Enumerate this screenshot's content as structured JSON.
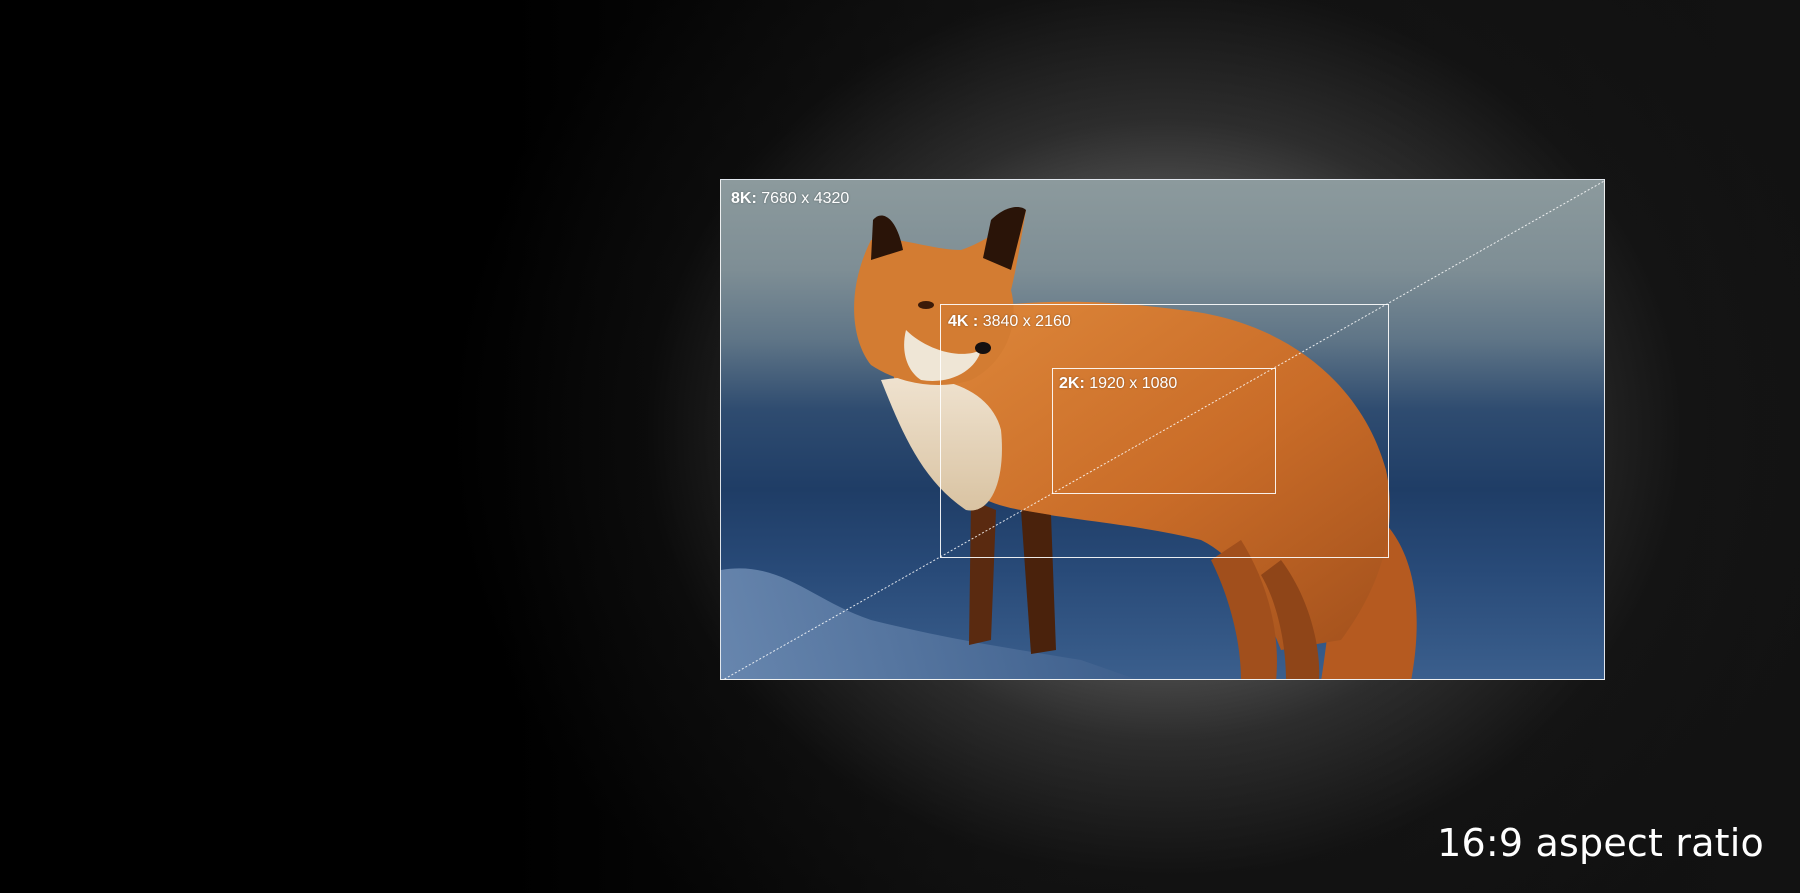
{
  "resolutions": {
    "r8k": {
      "name": "8K:",
      "dims": "7680 x 4320"
    },
    "r4k": {
      "name": "4K :",
      "dims": "3840 x 2160"
    },
    "r2k": {
      "name": "2K:",
      "dims": "1920 x 1080"
    }
  },
  "caption": "16:9 aspect ratio",
  "colors": {
    "frame_stroke": "#ffffff",
    "background": "#000000",
    "text": "#ffffff"
  },
  "image_subject": "fox-photo"
}
